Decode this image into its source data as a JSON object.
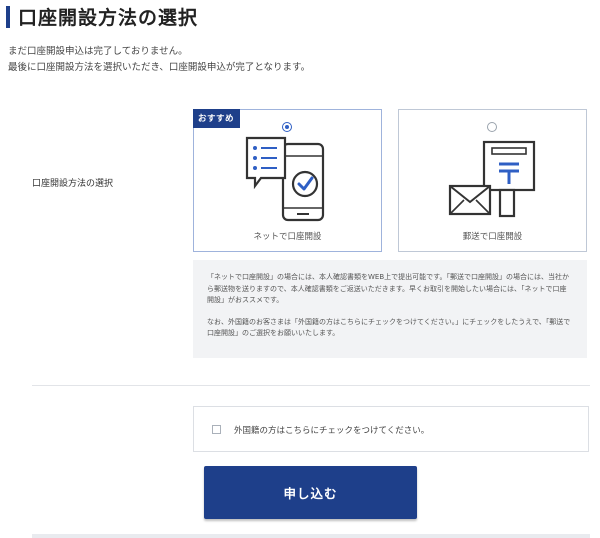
{
  "page": {
    "title": "口座開設方法の選択",
    "intro_line1": "まだ口座開設申込は完了しておりません。",
    "intro_line2": "最後に口座開設方法を選択いただき、口座開設申込が完了となります。"
  },
  "selection": {
    "label": "口座開設方法の選択",
    "options": [
      {
        "label": "ネットで口座開設",
        "badge": "おすすめ",
        "selected": true,
        "icon": "smartphone-chat-check-icon"
      },
      {
        "label": "郵送で口座開設",
        "badge": "",
        "selected": false,
        "icon": "mailbox-envelope-icon"
      }
    ]
  },
  "note": {
    "para1": "「ネットで口座開設」の場合には、本人確認書類をWEB上で提出可能です。「郵送で口座開設」の場合には、当社から郵送物を送りますので、本人確認書類をご返送いただきます。早くお取引を開始したい場合には、「ネットで口座開設」がおススメです。",
    "para2": "なお、外国籍のお客さまは「外国籍の方はこちらにチェックをつけてください。」にチェックをしたうえで、「郵送で口座開設」のご選択をお願いいたします。"
  },
  "foreign_check": {
    "label": "外国籍の方はこちらにチェックをつけてください。",
    "checked": false
  },
  "submit": {
    "label": "申し込む"
  },
  "colors": {
    "accent": "#1e3f8a",
    "radio": "#2f5fc4",
    "note_bg": "#f2f3f5"
  }
}
